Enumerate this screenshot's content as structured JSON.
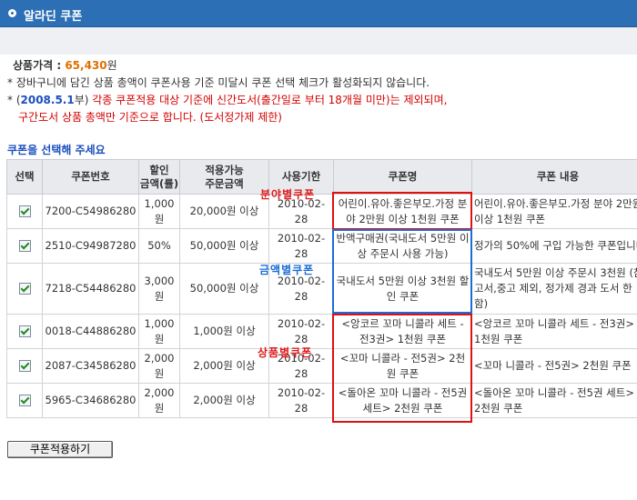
{
  "header": {
    "title": "알라딘 쿠폰"
  },
  "info": {
    "price_label": "상품가격 : ",
    "price_value": "65,430",
    "price_unit": "원",
    "note1": "* 장바구니에 담긴 상품 총액이 쿠폰사용 기준 미달시 쿠폰 선택 체크가 활성화되지 않습니다.",
    "note2_prefix": "* (",
    "note2_date": "2008.5.1",
    "note2_mid": "부) ",
    "note2_red": "각종 쿠폰적용 대상 기준에 신간도서(출간일로 부터 18개월 미만)는 제외되며,",
    "note3_red": "구간도서 상품 총액만 기준으로 합니다. (도서정가제 제한)"
  },
  "select_title": "쿠폰을 선택해 주세요",
  "table": {
    "headers": [
      "선택",
      "쿠폰번호",
      "할인\n금액(률)",
      "적용가능\n주문금액",
      "사용기한",
      "쿠폰명",
      "쿠폰 내용"
    ],
    "rows": [
      {
        "code": "7200-C54986280",
        "discount": "1,000원",
        "min": "20,000원 이상",
        "expiry": "2010-02-28",
        "name": "어린이.유아.좋은부모.가정 분야 2만원 이상 1천원 쿠폰",
        "content": "어린이.유아.좋은부모.가정 분야 2만원 이상 1천원 쿠폰"
      },
      {
        "code": "2510-C94987280",
        "discount": "50%",
        "min": "50,000원 이상",
        "expiry": "2010-02-28",
        "name": "반액구매권(국내도서 5만원 이상 주문시 사용 가능)",
        "content": "정가의 50%에 구입 가능한 쿠폰입니다."
      },
      {
        "code": "7218-C54486280",
        "discount": "3,000원",
        "min": "50,000원 이상",
        "expiry": "2010-02-28",
        "name": "국내도서 5만원 이상 3천원 할인 쿠폰",
        "content": "국내도서 5만원 이상 주문시 3천원 (참고서,중고 제외, 정가제 경과 도서 한함)"
      },
      {
        "code": "0018-C44886280",
        "discount": "1,000원",
        "min": "1,000원 이상",
        "expiry": "2010-02-28",
        "name": "<앙코르 꼬마 니콜라 세트 - 전3권> 1천원 쿠폰",
        "content": "<앙코르 꼬마 니콜라 세트 - 전3권> 1천원 쿠폰"
      },
      {
        "code": "2087-C34586280",
        "discount": "2,000원",
        "min": "2,000원 이상",
        "expiry": "2010-02-28",
        "name": "<꼬마 니콜라 - 전5권> 2천원 쿠폰",
        "content": "<꼬마 니콜라 - 전5권> 2천원 쿠폰"
      },
      {
        "code": "5965-C34686280",
        "discount": "2,000원",
        "min": "2,000원 이상",
        "expiry": "2010-02-28",
        "name": "<돌아온 꼬마 니콜라 - 전5권 세트> 2천원 쿠폰",
        "content": "<돌아온 꼬마 니콜라 - 전5권 세트> 2천원 쿠폰"
      }
    ]
  },
  "annotations": {
    "category": "분야별쿠폰",
    "amount": "금액별쿠폰",
    "product": "상품별쿠폰"
  },
  "apply_button": "쿠폰적용하기"
}
